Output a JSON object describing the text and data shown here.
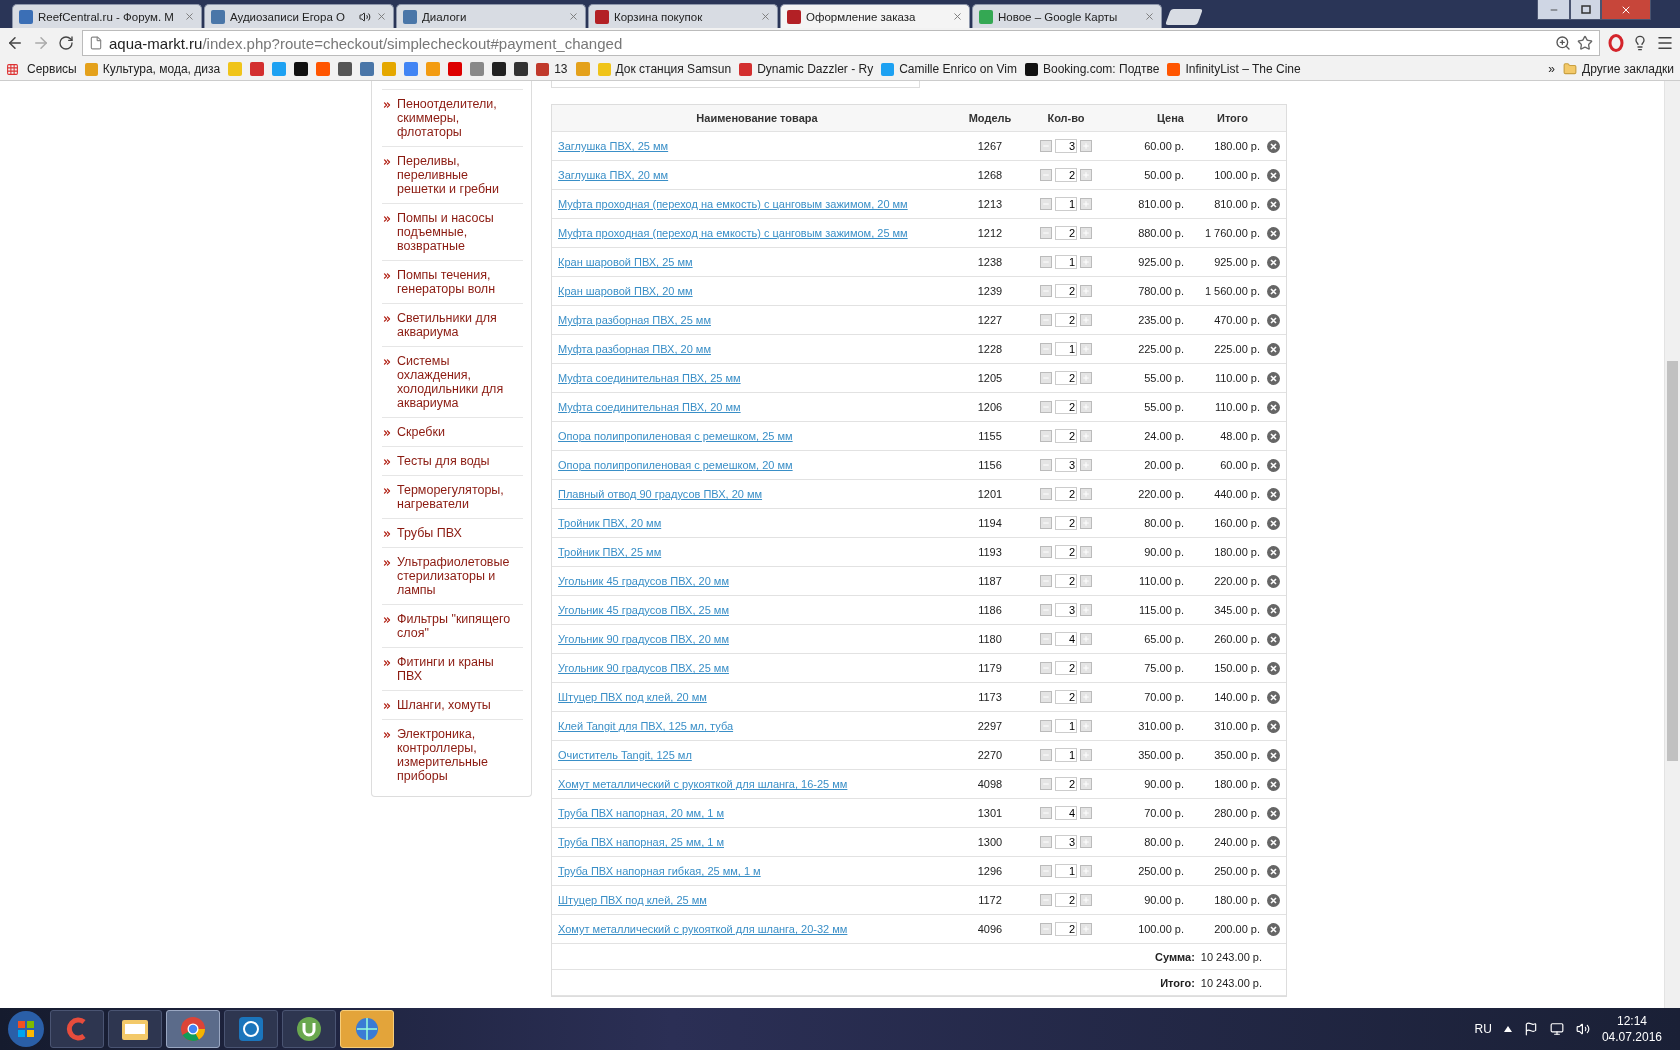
{
  "browser": {
    "tabs": [
      {
        "title": "ReefCentral.ru - Форум. M",
        "selected": false,
        "audio": false
      },
      {
        "title": "Аудиозаписи Егора О",
        "selected": false,
        "audio": true
      },
      {
        "title": "Диалоги",
        "selected": false,
        "audio": false
      },
      {
        "title": "Корзина покупок",
        "selected": false,
        "audio": false
      },
      {
        "title": "Оформление заказа",
        "selected": true,
        "audio": false
      },
      {
        "title": "Новое – Google Карты",
        "selected": false,
        "audio": false
      }
    ],
    "address": {
      "host": "aqua-markt.ru",
      "path": "/index.php?route=checkout/simplecheckout#payment_changed"
    },
    "bookmarks": [
      {
        "kind": "link",
        "label": "Сервисы"
      },
      {
        "kind": "link",
        "label": "Культура, мода, диза"
      },
      {
        "kind": "icon"
      },
      {
        "kind": "icon"
      },
      {
        "kind": "icon"
      },
      {
        "kind": "icon"
      },
      {
        "kind": "icon"
      },
      {
        "kind": "icon"
      },
      {
        "kind": "icon"
      },
      {
        "kind": "icon"
      },
      {
        "kind": "icon"
      },
      {
        "kind": "icon"
      },
      {
        "kind": "icon"
      },
      {
        "kind": "icon"
      },
      {
        "kind": "icon"
      },
      {
        "kind": "icon"
      },
      {
        "kind": "link",
        "label": "13"
      },
      {
        "kind": "icon"
      },
      {
        "kind": "link",
        "label": "Док станция Samsun"
      },
      {
        "kind": "link",
        "label": "Dynamic Dazzler - Ry"
      },
      {
        "kind": "link",
        "label": "Camille Enrico on Vim"
      },
      {
        "kind": "link",
        "label": "Booking.com: Подтве"
      },
      {
        "kind": "link",
        "label": "InfinityList – The Cine"
      }
    ],
    "bookmarks_overflow": "»",
    "other_bookmarks": "Другие закладки"
  },
  "sidebar": {
    "items": [
      "Пеноотделители, скиммеры, флотаторы",
      "Переливы, переливные решетки и гребни",
      "Помпы и насосы подъемные, возвратные",
      "Помпы течения, генераторы волн",
      "Светильники для аквариума",
      "Системы охлаждения, холодильники для аквариума",
      "Скребки",
      "Тесты для воды",
      "Терморегуляторы, нагреватели",
      "Трубы ПВХ",
      "Ультрафиолетовые стерилизаторы и лампы",
      "Фильтры \"кипящего слоя\"",
      "Фитинги и краны ПВХ",
      "Шланги, хомуты",
      "Электроника, контроллеры, измерительные приборы"
    ]
  },
  "cart": {
    "columns": [
      "Наименование товара",
      "Модель",
      "Кол-во",
      "Цена",
      "Итого"
    ],
    "rows": [
      {
        "name": "Заглушка ПВХ, 25 мм",
        "model": "1267",
        "qty": "3",
        "price": "60.00 р.",
        "total": "180.00 р."
      },
      {
        "name": "Заглушка ПВХ, 20 мм",
        "model": "1268",
        "qty": "2",
        "price": "50.00 р.",
        "total": "100.00 р."
      },
      {
        "name": "Муфта проходная (переход на емкость) с цанговым зажимом, 20 мм",
        "model": "1213",
        "qty": "1",
        "price": "810.00 р.",
        "total": "810.00 р."
      },
      {
        "name": "Муфта проходная (переход на емкость) с цанговым зажимом, 25 мм",
        "model": "1212",
        "qty": "2",
        "price": "880.00 р.",
        "total": "1 760.00 р."
      },
      {
        "name": "Кран шаровой ПВХ, 25 мм",
        "model": "1238",
        "qty": "1",
        "price": "925.00 р.",
        "total": "925.00 р."
      },
      {
        "name": "Кран шаровой ПВХ, 20 мм",
        "model": "1239",
        "qty": "2",
        "price": "780.00 р.",
        "total": "1 560.00 р."
      },
      {
        "name": "Муфта разборная ПВХ, 25 мм",
        "model": "1227",
        "qty": "2",
        "price": "235.00 р.",
        "total": "470.00 р."
      },
      {
        "name": "Муфта разборная ПВХ, 20 мм",
        "model": "1228",
        "qty": "1",
        "price": "225.00 р.",
        "total": "225.00 р."
      },
      {
        "name": "Муфта соединительная ПВХ, 25 мм",
        "model": "1205",
        "qty": "2",
        "price": "55.00 р.",
        "total": "110.00 р."
      },
      {
        "name": "Муфта соединительная ПВХ, 20 мм",
        "model": "1206",
        "qty": "2",
        "price": "55.00 р.",
        "total": "110.00 р."
      },
      {
        "name": "Опора полипропиленовая с ремешком, 25 мм",
        "model": "1155",
        "qty": "2",
        "price": "24.00 р.",
        "total": "48.00 р."
      },
      {
        "name": "Опора полипропиленовая с ремешком, 20 мм",
        "model": "1156",
        "qty": "3",
        "price": "20.00 р.",
        "total": "60.00 р."
      },
      {
        "name": "Плавный отвод 90 градусов ПВХ, 20 мм",
        "model": "1201",
        "qty": "2",
        "price": "220.00 р.",
        "total": "440.00 р."
      },
      {
        "name": "Тройник ПВХ, 20 мм",
        "model": "1194",
        "qty": "2",
        "price": "80.00 р.",
        "total": "160.00 р."
      },
      {
        "name": "Тройник ПВХ, 25 мм",
        "model": "1193",
        "qty": "2",
        "price": "90.00 р.",
        "total": "180.00 р."
      },
      {
        "name": "Угольник 45 градусов ПВХ, 20 мм",
        "model": "1187",
        "qty": "2",
        "price": "110.00 р.",
        "total": "220.00 р."
      },
      {
        "name": "Угольник 45 градусов ПВХ, 25 мм",
        "model": "1186",
        "qty": "3",
        "price": "115.00 р.",
        "total": "345.00 р."
      },
      {
        "name": "Угольник 90 градусов ПВХ, 20 мм",
        "model": "1180",
        "qty": "4",
        "price": "65.00 р.",
        "total": "260.00 р."
      },
      {
        "name": "Угольник 90 градусов ПВХ, 25 мм",
        "model": "1179",
        "qty": "2",
        "price": "75.00 р.",
        "total": "150.00 р."
      },
      {
        "name": "Штуцер ПВХ под клей, 20 мм",
        "model": "1173",
        "qty": "2",
        "price": "70.00 р.",
        "total": "140.00 р."
      },
      {
        "name": "Клей Tangit для ПВХ, 125 мл, туба",
        "model": "2297",
        "qty": "1",
        "price": "310.00 р.",
        "total": "310.00 р."
      },
      {
        "name": "Очиститель Tangit, 125 мл",
        "model": "2270",
        "qty": "1",
        "price": "350.00 р.",
        "total": "350.00 р."
      },
      {
        "name": "Хомут металлический с рукояткой для шланга, 16-25 мм",
        "model": "4098",
        "qty": "2",
        "price": "90.00 р.",
        "total": "180.00 р."
      },
      {
        "name": "Труба ПВХ напорная, 20 мм, 1 м",
        "model": "1301",
        "qty": "4",
        "price": "70.00 р.",
        "total": "280.00 р."
      },
      {
        "name": "Труба ПВХ напорная, 25 мм, 1 м",
        "model": "1300",
        "qty": "3",
        "price": "80.00 р.",
        "total": "240.00 р."
      },
      {
        "name": "Труба ПВХ напорная гибкая, 25 мм, 1 м",
        "model": "1296",
        "qty": "1",
        "price": "250.00 р.",
        "total": "250.00 р."
      },
      {
        "name": "Штуцер ПВХ под клей, 25 мм",
        "model": "1172",
        "qty": "2",
        "price": "90.00 р.",
        "total": "180.00 р."
      },
      {
        "name": "Хомут металлический с рукояткой для шланга, 20-32 мм",
        "model": "4096",
        "qty": "2",
        "price": "100.00 р.",
        "total": "200.00 р."
      }
    ],
    "summary": [
      {
        "label": "Сумма:",
        "value": "10 243.00 р."
      },
      {
        "label": "Итого:",
        "value": "10 243.00 р."
      }
    ]
  },
  "taskbar": {
    "apps": [
      {
        "kind": "ccleaner",
        "selected": false,
        "highlighted": false
      },
      {
        "kind": "explorer",
        "selected": false,
        "highlighted": false
      },
      {
        "kind": "chrome",
        "selected": true,
        "highlighted": false
      },
      {
        "kind": "player",
        "selected": false,
        "highlighted": false
      },
      {
        "kind": "torrent",
        "selected": false,
        "highlighted": false
      },
      {
        "kind": "globe",
        "selected": false,
        "highlighted": true
      }
    ],
    "language": "RU",
    "time": "12:14",
    "date": "04.07.2016"
  }
}
